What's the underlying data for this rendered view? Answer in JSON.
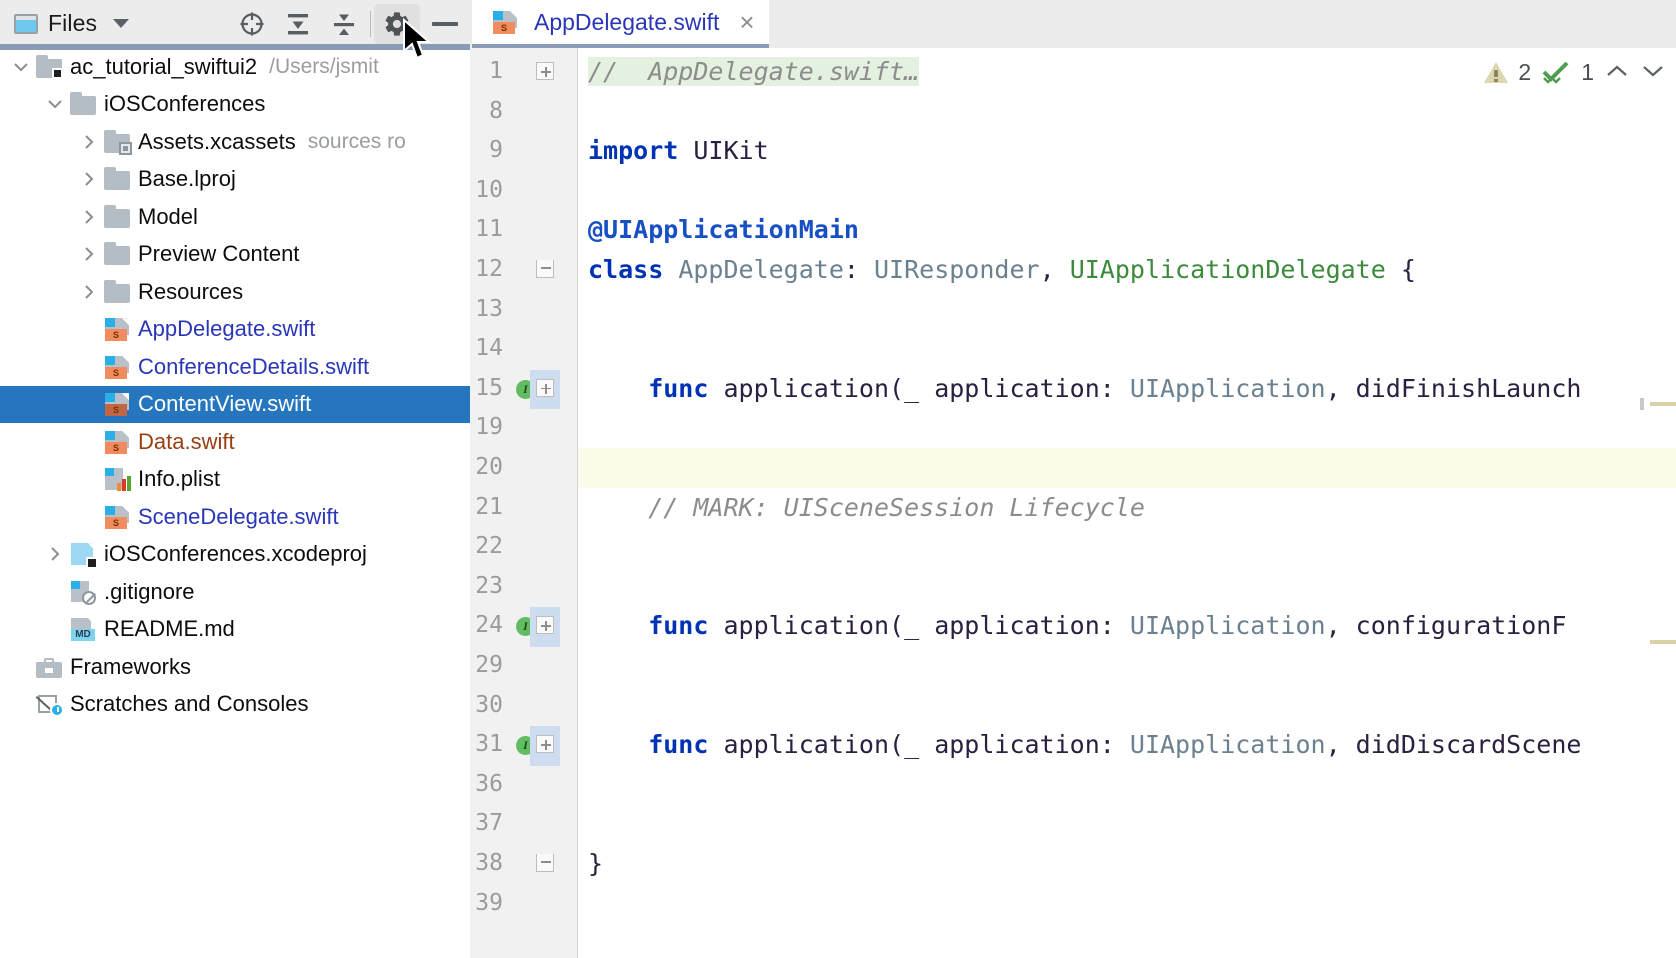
{
  "tool_window": {
    "title": "Files",
    "icons": {
      "window": "window-icon",
      "dropdown": "chevron-down-icon",
      "locate": "scroll-from-source-icon",
      "expand_all": "expand-all-icon",
      "collapse_all": "collapse-all-icon",
      "settings": "gear-icon",
      "hide": "minimize-icon"
    }
  },
  "tree": [
    {
      "label": "ac_tutorial_swiftui2",
      "sub": "/Users/jsmit",
      "icon": "module-folder-icon",
      "indent": 0,
      "arrow": "down",
      "type": "module",
      "selected": false
    },
    {
      "label": "iOSConferences",
      "sub": "",
      "icon": "folder-icon",
      "indent": 1,
      "arrow": "down",
      "type": "folder",
      "selected": false
    },
    {
      "label": "Assets.xcassets",
      "sub": "sources ro",
      "icon": "xcassets-folder-icon",
      "indent": 2,
      "arrow": "right",
      "type": "xcassets",
      "selected": false
    },
    {
      "label": "Base.lproj",
      "sub": "",
      "icon": "folder-icon",
      "indent": 2,
      "arrow": "right",
      "type": "folder",
      "selected": false
    },
    {
      "label": "Model",
      "sub": "",
      "icon": "folder-icon",
      "indent": 2,
      "arrow": "right",
      "type": "folder",
      "selected": false
    },
    {
      "label": "Preview Content",
      "sub": "",
      "icon": "folder-icon",
      "indent": 2,
      "arrow": "right",
      "type": "folder",
      "selected": false
    },
    {
      "label": "Resources",
      "sub": "",
      "icon": "folder-icon",
      "indent": 2,
      "arrow": "right",
      "type": "folder",
      "selected": false
    },
    {
      "label": "AppDelegate.swift",
      "sub": "",
      "icon": "swift-file-icon",
      "indent": 2,
      "arrow": "none",
      "type": "swift",
      "color": "blue",
      "selected": false
    },
    {
      "label": "ConferenceDetails.swift",
      "sub": "",
      "icon": "swift-file-icon",
      "indent": 2,
      "arrow": "none",
      "type": "swift",
      "color": "blue",
      "selected": false
    },
    {
      "label": "ContentView.swift",
      "sub": "",
      "icon": "swift-file-icon",
      "indent": 2,
      "arrow": "none",
      "type": "swift",
      "color": "white",
      "selected": true
    },
    {
      "label": "Data.swift",
      "sub": "",
      "icon": "swift-file-icon",
      "indent": 2,
      "arrow": "none",
      "type": "swift",
      "color": "brown",
      "selected": false
    },
    {
      "label": "Info.plist",
      "sub": "",
      "icon": "plist-file-icon",
      "indent": 2,
      "arrow": "none",
      "type": "plist",
      "color": "black",
      "selected": false
    },
    {
      "label": "SceneDelegate.swift",
      "sub": "",
      "icon": "swift-file-icon",
      "indent": 2,
      "arrow": "none",
      "type": "swift",
      "color": "blue",
      "selected": false
    },
    {
      "label": "iOSConferences.xcodeproj",
      "sub": "",
      "icon": "xcodeproj-icon",
      "indent": 1,
      "arrow": "right",
      "type": "xcodeproj",
      "color": "black",
      "selected": false
    },
    {
      "label": ".gitignore",
      "sub": "",
      "icon": "gitignore-file-icon",
      "indent": 1,
      "arrow": "none",
      "type": "gitignore",
      "color": "black",
      "selected": false
    },
    {
      "label": "README.md",
      "sub": "",
      "icon": "markdown-file-icon",
      "indent": 1,
      "arrow": "none",
      "type": "md",
      "color": "black",
      "selected": false
    },
    {
      "label": "Frameworks",
      "sub": "",
      "icon": "frameworks-icon",
      "indent": 0,
      "arrow": "none",
      "type": "frameworks",
      "color": "black",
      "selected": false
    },
    {
      "label": "Scratches and Consoles",
      "sub": "",
      "icon": "scratches-icon",
      "indent": 0,
      "arrow": "none",
      "type": "scratches",
      "color": "black",
      "selected": false
    }
  ],
  "editor": {
    "tab": {
      "filename": "AppDelegate.swift",
      "close": "×",
      "icon": "swift-file-icon"
    },
    "inspection": {
      "warning_count": "2",
      "check_count": "1",
      "warning_icon": "warning-triangle-icon",
      "ok_icon": "double-check-icon",
      "prev_icon": "chevron-up-icon",
      "next_icon": "chevron-down-icon"
    },
    "lines": [
      {
        "num": "1",
        "fold": "plus",
        "marker": "none",
        "highlight": "comment-first",
        "caret": false,
        "tokens": [
          {
            "t": "// ",
            "c": "cmt"
          },
          {
            "t": " AppDelegate.swift…",
            "c": "cmt"
          }
        ]
      },
      {
        "num": "8",
        "fold": "none",
        "marker": "none",
        "highlight": "none",
        "caret": false,
        "tokens": []
      },
      {
        "num": "9",
        "fold": "none",
        "marker": "none",
        "highlight": "none",
        "caret": false,
        "tokens": [
          {
            "t": "import",
            "c": "kw"
          },
          {
            "t": " UIKit",
            "c": "plain"
          }
        ]
      },
      {
        "num": "10",
        "fold": "none",
        "marker": "none",
        "highlight": "none",
        "caret": false,
        "tokens": []
      },
      {
        "num": "11",
        "fold": "none",
        "marker": "none",
        "highlight": "none",
        "caret": false,
        "tokens": [
          {
            "t": "@UIApplicationMain",
            "c": "anno"
          }
        ]
      },
      {
        "num": "12",
        "fold": "end",
        "marker": "none",
        "highlight": "none",
        "caret": false,
        "tokens": [
          {
            "t": "class",
            "c": "kw"
          },
          {
            "t": " AppDelegate",
            "c": "type"
          },
          {
            "t": ":",
            "c": "punc"
          },
          {
            "t": " UIResponder",
            "c": "type"
          },
          {
            "t": ",",
            "c": "punc"
          },
          {
            "t": " UIApplicationDelegate",
            "c": "proto"
          },
          {
            "t": " {",
            "c": "punc"
          }
        ]
      },
      {
        "num": "13",
        "fold": "none",
        "marker": "none",
        "highlight": "none",
        "caret": false,
        "tokens": []
      },
      {
        "num": "14",
        "fold": "none",
        "marker": "none",
        "highlight": "none",
        "caret": false,
        "tokens": []
      },
      {
        "num": "15",
        "fold": "plus",
        "marker": "implements",
        "highlight": "none",
        "caret": false,
        "tokens": [
          {
            "t": "    func",
            "c": "kw"
          },
          {
            "t": " application",
            "c": "ident"
          },
          {
            "t": "(_ ",
            "c": "punc"
          },
          {
            "t": "application",
            "c": "ident"
          },
          {
            "t": ": ",
            "c": "punc"
          },
          {
            "t": "UIApplication",
            "c": "type"
          },
          {
            "t": ", ",
            "c": "punc"
          },
          {
            "t": "didFinishLaunch",
            "c": "ident"
          }
        ]
      },
      {
        "num": "19",
        "fold": "none",
        "marker": "none",
        "highlight": "none",
        "caret": false,
        "tokens": []
      },
      {
        "num": "20",
        "fold": "none",
        "marker": "none",
        "highlight": "none",
        "caret": true,
        "tokens": []
      },
      {
        "num": "21",
        "fold": "none",
        "marker": "none",
        "highlight": "none",
        "caret": false,
        "tokens": [
          {
            "t": "    // MARK: UISceneSession Lifecycle",
            "c": "cmt"
          }
        ]
      },
      {
        "num": "22",
        "fold": "none",
        "marker": "none",
        "highlight": "none",
        "caret": false,
        "tokens": []
      },
      {
        "num": "23",
        "fold": "none",
        "marker": "none",
        "highlight": "none",
        "caret": false,
        "tokens": []
      },
      {
        "num": "24",
        "fold": "plus",
        "marker": "implements",
        "highlight": "none",
        "caret": false,
        "tokens": [
          {
            "t": "    func",
            "c": "kw"
          },
          {
            "t": " application",
            "c": "ident"
          },
          {
            "t": "(_ ",
            "c": "punc"
          },
          {
            "t": "application",
            "c": "ident"
          },
          {
            "t": ": ",
            "c": "punc"
          },
          {
            "t": "UIApplication",
            "c": "type"
          },
          {
            "t": ", ",
            "c": "punc"
          },
          {
            "t": "configurationF",
            "c": "ident"
          }
        ]
      },
      {
        "num": "29",
        "fold": "none",
        "marker": "none",
        "highlight": "none",
        "caret": false,
        "tokens": []
      },
      {
        "num": "30",
        "fold": "none",
        "marker": "none",
        "highlight": "none",
        "caret": false,
        "tokens": []
      },
      {
        "num": "31",
        "fold": "plus",
        "marker": "implements",
        "highlight": "none",
        "caret": false,
        "tokens": [
          {
            "t": "    func",
            "c": "kw"
          },
          {
            "t": " application",
            "c": "ident"
          },
          {
            "t": "(_ ",
            "c": "punc"
          },
          {
            "t": "application",
            "c": "ident"
          },
          {
            "t": ": ",
            "c": "punc"
          },
          {
            "t": "UIApplication",
            "c": "type"
          },
          {
            "t": ", ",
            "c": "punc"
          },
          {
            "t": "didDiscardScene",
            "c": "ident"
          }
        ]
      },
      {
        "num": "36",
        "fold": "none",
        "marker": "none",
        "highlight": "none",
        "caret": false,
        "tokens": []
      },
      {
        "num": "37",
        "fold": "none",
        "marker": "none",
        "highlight": "none",
        "caret": false,
        "tokens": []
      },
      {
        "num": "38",
        "fold": "end",
        "marker": "none",
        "highlight": "none",
        "caret": false,
        "tokens": [
          {
            "t": "}",
            "c": "punc"
          }
        ]
      },
      {
        "num": "39",
        "fold": "none",
        "marker": "none",
        "highlight": "none",
        "caret": false,
        "tokens": []
      }
    ]
  },
  "colors": {
    "selection_blue": "#2675bf",
    "keyword_blue": "#0033b3",
    "link_blue": "#2a36b8",
    "protocol_green": "#3c8a3c",
    "caret_line": "#fcfae8",
    "comment_highlight": "#e4f1e0",
    "toolbar_bg": "#ececec",
    "gutter_bg": "#f1f1f1"
  }
}
